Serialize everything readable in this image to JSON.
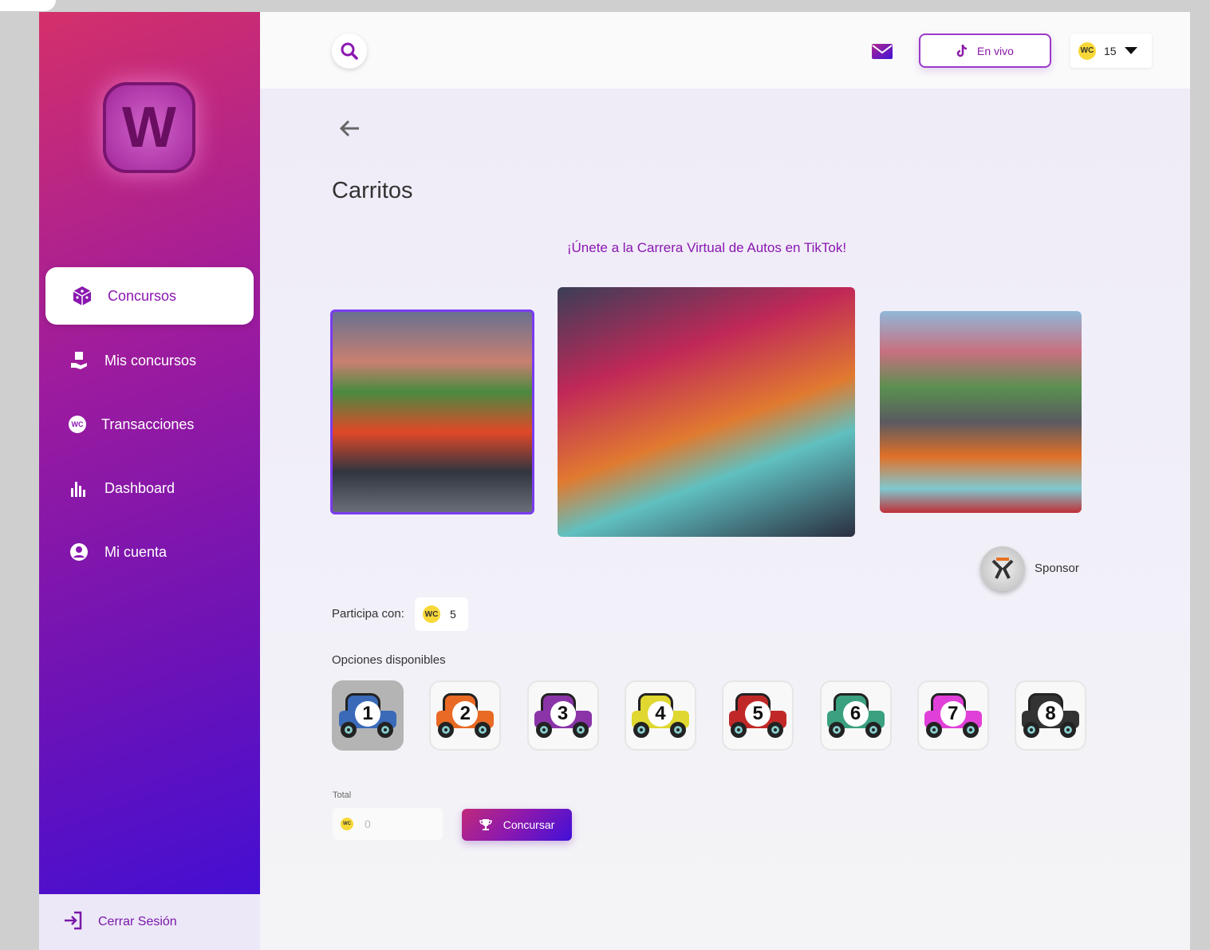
{
  "sidebar": {
    "logo_letter": "W",
    "items": [
      {
        "label": "Concursos",
        "icon": "dice-icon",
        "active": true
      },
      {
        "label": "Mis concursos",
        "icon": "hand-box-icon"
      },
      {
        "label": "Transacciones",
        "icon": "wc-coin-icon"
      },
      {
        "label": "Dashboard",
        "icon": "bar-chart-icon"
      },
      {
        "label": "Mi cuenta",
        "icon": "user-circle-icon"
      }
    ],
    "logout": "Cerrar Sesión"
  },
  "header": {
    "live_label": "En vivo",
    "coin": "WC",
    "balance": "15"
  },
  "page": {
    "title": "Carritos",
    "subtitle": "¡Únete a la Carrera Virtual de Autos en TikTok!",
    "sponsor": "Sponsor",
    "participate_label": "Participa con:",
    "participate_amount": "5",
    "options_label": "Opciones disponibles",
    "options": [
      {
        "num": "1",
        "color": "#3a6ab8",
        "selected": true
      },
      {
        "num": "2",
        "color": "#e86a24"
      },
      {
        "num": "3",
        "color": "#8a34a8"
      },
      {
        "num": "4",
        "color": "#e0d830"
      },
      {
        "num": "5",
        "color": "#c02828"
      },
      {
        "num": "6",
        "color": "#3aa080"
      },
      {
        "num": "7",
        "color": "#e040d8"
      },
      {
        "num": "8",
        "color": "#333333"
      }
    ],
    "total_label": "Total",
    "total_value": "0",
    "submit": "Concursar"
  },
  "colors": {
    "accent": "#8a17b0",
    "gradient_start": "#d4306a",
    "gradient_end": "#3c0ed8"
  }
}
